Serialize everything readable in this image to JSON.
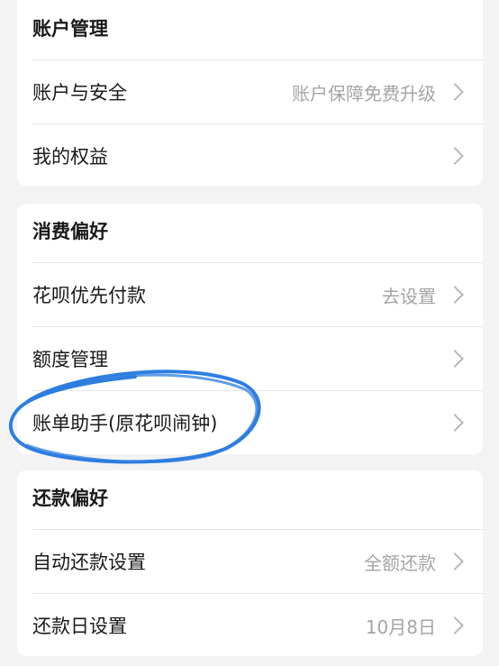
{
  "sections": [
    {
      "title": "账户管理",
      "rows": [
        {
          "label": "账户与安全",
          "value": "账户保障免费升级"
        },
        {
          "label": "我的权益",
          "value": ""
        }
      ]
    },
    {
      "title": "消费偏好",
      "rows": [
        {
          "label": "花呗优先付款",
          "value": "去设置"
        },
        {
          "label": "额度管理",
          "value": ""
        },
        {
          "label": "账单助手(原花呗闹钟)",
          "value": ""
        }
      ]
    },
    {
      "title": "还款偏好",
      "rows": [
        {
          "label": "自动还款设置",
          "value": "全额还款"
        },
        {
          "label": "还款日设置",
          "value": "10月8日"
        }
      ]
    }
  ],
  "annotation_color": "#2e7ee0"
}
